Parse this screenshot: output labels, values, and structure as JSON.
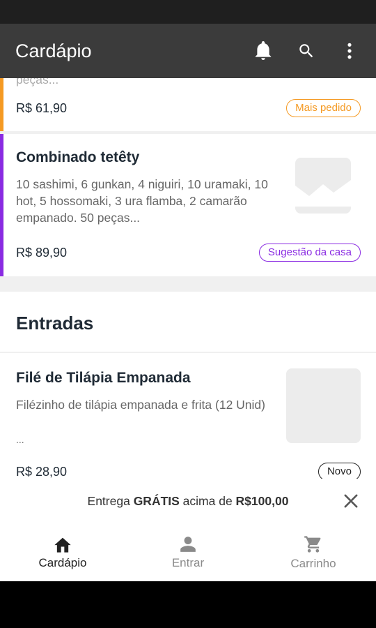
{
  "app_bar": {
    "title": "Cardápio",
    "icons": [
      "bell-icon",
      "search-icon",
      "more-vert-icon"
    ]
  },
  "items": [
    {
      "desc_partial": "peças...",
      "price": "R$ 61,90",
      "badge": "Mais pedido",
      "accent_color": "#f59a23"
    },
    {
      "name": "Combinado tetêty",
      "desc": "10 sashimi, 6 gunkan, 4 niguiri, 10 uramaki, 10 hot, 5 hossomaki, 3 ura flamba, 2 camarão empanado. 50 peças...",
      "price": "R$ 89,90",
      "badge": "Sugestão da casa",
      "accent_color": "#8a2be2"
    }
  ],
  "section": {
    "title": "Entradas",
    "items": [
      {
        "name": "Filé de Tilápia Empanada",
        "desc": "Filézinho de tilápia empanada e frita (12 Unid)",
        "desc_more": "...",
        "price": "R$ 28,90",
        "badge": "Novo"
      }
    ]
  },
  "promo": {
    "prefix": "Entrega ",
    "bold1": "GRÁTIS",
    "middle": " acima de ",
    "bold2": "R$100,00"
  },
  "bottom_nav": [
    {
      "label": "Cardápio",
      "icon": "home-icon",
      "active": true
    },
    {
      "label": "Entrar",
      "icon": "person-icon",
      "active": false
    },
    {
      "label": "Carrinho",
      "icon": "cart-icon",
      "active": false
    }
  ],
  "colors": {
    "app_bar": "#3b3b3b",
    "badge_orange": "#f59a23",
    "badge_purple": "#8a2be2",
    "badge_dark": "#222222"
  }
}
